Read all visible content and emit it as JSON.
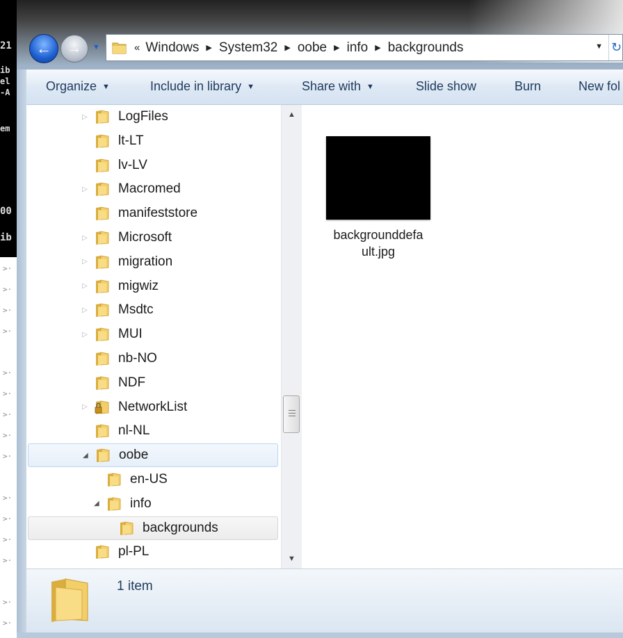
{
  "terminal_fragments": [
    "21",
    "ib",
    "el",
    "-A",
    "em",
    "00",
    "ib"
  ],
  "address": {
    "overflow": "«",
    "breadcrumbs": [
      "Windows",
      "System32",
      "oobe",
      "info",
      "backgrounds"
    ]
  },
  "toolbar": {
    "organize": "Organize",
    "include": "Include in library",
    "share": "Share with",
    "slideshow": "Slide show",
    "burn": "Burn",
    "newfolder": "New fol"
  },
  "tree": [
    {
      "label": "LogFiles",
      "expandable": true
    },
    {
      "label": "lt-LT",
      "expandable": false
    },
    {
      "label": "lv-LV",
      "expandable": false
    },
    {
      "label": "Macromed",
      "expandable": true
    },
    {
      "label": "manifeststore",
      "expandable": false
    },
    {
      "label": "Microsoft",
      "expandable": true
    },
    {
      "label": "migration",
      "expandable": true
    },
    {
      "label": "migwiz",
      "expandable": true
    },
    {
      "label": "Msdtc",
      "expandable": true
    },
    {
      "label": "MUI",
      "expandable": true
    },
    {
      "label": "nb-NO",
      "expandable": false
    },
    {
      "label": "NDF",
      "expandable": false
    },
    {
      "label": "NetworkList",
      "expandable": true,
      "locked": true
    },
    {
      "label": "nl-NL",
      "expandable": false
    },
    {
      "label": "oobe",
      "expanded": true
    },
    {
      "label": "en-US",
      "expandable": false
    },
    {
      "label": "info",
      "expanded": true
    },
    {
      "label": "backgrounds",
      "selected": true
    },
    {
      "label": "pl-PL",
      "expandable": false
    }
  ],
  "file": {
    "name": "backgrounddefault.jpg",
    "name_line1": "backgrounddefa",
    "name_line2": "ult.jpg"
  },
  "status": {
    "count": "1 item"
  },
  "colors": {
    "accent": "#1d5fd1",
    "toolbar_text": "#1e395b",
    "folder": "#e8c45a"
  }
}
